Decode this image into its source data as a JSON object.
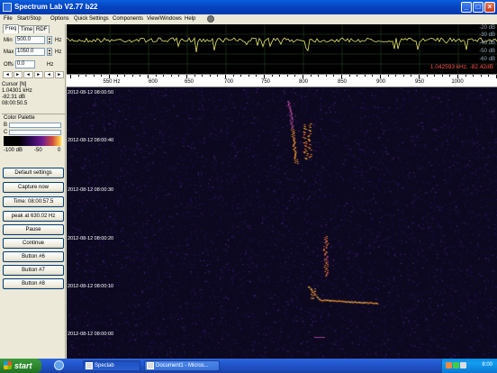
{
  "window": {
    "title": "Spectrum Lab V2.77 b22",
    "controls": [
      "_",
      "□",
      "×"
    ]
  },
  "menu": [
    "File",
    "Start/Stop",
    "Options",
    "Quick Settings",
    "Components",
    "View/Windows",
    "Help"
  ],
  "left_panel": {
    "tabs": [
      "Freq",
      "Time",
      "RDF"
    ],
    "min_label": "Min",
    "min_value": "500.0",
    "max_label": "Max",
    "max_value": "1050.0",
    "unit_hz": "Hz",
    "offs_label": "Offs",
    "offs_value": "0.0",
    "offs_unit": "Hz",
    "scroll_arrows": [
      "◄",
      "►",
      "◄",
      "►",
      "◄",
      "►"
    ],
    "cursor_title": "Cursor [N]",
    "cursor_freq": "1.04301 kHz",
    "cursor_db": "-82.31 dB",
    "cursor_time": "08:00:50.5",
    "palette_title": "Color Palette",
    "b_label": "B",
    "c_label": "C",
    "scale_labels": [
      "-100 dB",
      "-50",
      "0"
    ],
    "buttons": [
      "Default settings",
      "Capture now",
      "Time: 08:00:57.5",
      "peak at 630.02 Hz",
      "Pause",
      "Continue",
      "Button #6",
      "Button #7",
      "Button #8"
    ]
  },
  "top_plot": {
    "db_labels": [
      "-20 dB",
      "-30 dB",
      "-40 dB",
      "-50 dB",
      "-60 dB"
    ],
    "readout": "1.042593 kHz, -82.42dB"
  },
  "freq_axis": {
    "labels": [
      "550 Hz",
      "600",
      "650",
      "700",
      "750",
      "800",
      "850",
      "900",
      "950",
      "1000"
    ]
  },
  "waterfall": {
    "timestamps": [
      "2012-08-12 08:00:50",
      "2012-08-12 08:00:40",
      "2012-08-12 08:00:30",
      "2012-08-12 08:00:20",
      "2012-08-12 08:00:10",
      "2012-08-12 08:00:00"
    ]
  },
  "taskbar": {
    "start_label": "start",
    "items": [
      "Speclab",
      "Document1 - Micros..."
    ],
    "clock": "8:00"
  },
  "colors": {
    "title_bar": "#0a5fe0",
    "trace": "#e8e870",
    "readout": "#ff5050",
    "waterfall_bg": "#0c0820"
  }
}
